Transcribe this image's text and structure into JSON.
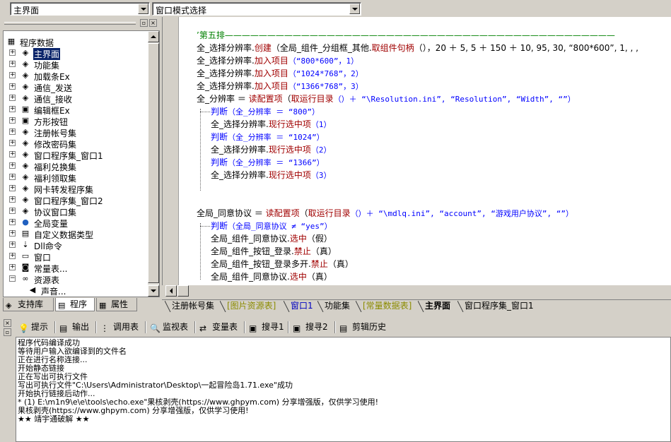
{
  "top": {
    "combo1": "主界面",
    "combo2": "窗口模式选择"
  },
  "tree": {
    "items": [
      {
        "label": "程序数据",
        "icon": "program-data-icon",
        "glyph": "▦"
      },
      {
        "label": "主界面",
        "icon": "layers-icon",
        "glyph": "◈"
      },
      {
        "label": "功能集",
        "icon": "layers-icon",
        "glyph": "◈"
      },
      {
        "label": "加载条Ex",
        "icon": "layers-icon",
        "glyph": "◈"
      },
      {
        "label": "通信_发送",
        "icon": "layers-icon",
        "glyph": "◈"
      },
      {
        "label": "通信_接收",
        "icon": "layers-icon",
        "glyph": "◈"
      },
      {
        "label": "编辑框Ex",
        "icon": "component-icon",
        "glyph": "▣"
      },
      {
        "label": "方形按钮",
        "icon": "component-icon",
        "glyph": "▣"
      },
      {
        "label": "注册帐号集",
        "icon": "layers-icon",
        "glyph": "◈"
      },
      {
        "label": "修改密码集",
        "icon": "layers-icon",
        "glyph": "◈"
      },
      {
        "label": "窗口程序集_窗口1",
        "icon": "layers-icon",
        "glyph": "◈"
      },
      {
        "label": "福利兑换集",
        "icon": "layers-icon",
        "glyph": "◈"
      },
      {
        "label": "福利领取集",
        "icon": "layers-icon",
        "glyph": "◈"
      },
      {
        "label": "网卡转发程序集",
        "icon": "layers-icon",
        "glyph": "◈"
      },
      {
        "label": "窗口程序集_窗口2",
        "icon": "layers-icon",
        "glyph": "◈"
      },
      {
        "label": "协议窗口集",
        "icon": "layers-icon",
        "glyph": "◈"
      },
      {
        "label": "全局变量",
        "icon": "globe-icon",
        "glyph": "●"
      },
      {
        "label": "自定义数据类型",
        "icon": "datatype-icon",
        "glyph": "▤"
      },
      {
        "label": "Dll命令",
        "icon": "dll-icon",
        "glyph": "⇣"
      },
      {
        "label": "窗口",
        "icon": "window-icon",
        "glyph": "▭"
      },
      {
        "label": "常量表...",
        "icon": "constant-icon",
        "glyph": "◙"
      },
      {
        "label": "资源表",
        "icon": "resource-icon",
        "glyph": "∞"
      },
      {
        "label": "声音...",
        "icon": "sound-icon",
        "glyph": "◀"
      }
    ],
    "tabs": [
      {
        "label": "支持库",
        "icon": "library-icon",
        "glyph": "◈"
      },
      {
        "label": "程序",
        "icon": "program-icon",
        "glyph": "▤"
      },
      {
        "label": "属性",
        "icon": "property-icon",
        "glyph": "▦"
      }
    ]
  },
  "code": {
    "l01": "’第五排——————————————————————————————————————————————",
    "l02a": "全_选择分辨率.",
    "l02b": "创建",
    "l02c": "（全局_组件_分组框_其他.",
    "l02d": "取组件句柄",
    "l02e": "（），20 ＋ 5, 5 ＋ 150 ＋ 10, 95, 30, “800*600”, 1, , , ",
    "l03a": "全_选择分辨率.",
    "l03b": "加入项目",
    "l03c": "（“800*600”，1）",
    "l04a": "全_选择分辨率.",
    "l04b": "加入项目",
    "l04c": "（“1024*768”，2）",
    "l05a": "全_选择分辨率.",
    "l05b": "加入项目",
    "l05c": "（“1366*768”，3）",
    "l06a": "全_分辨率 ＝ ",
    "l06b": "读配置项",
    "l06c": "（",
    "l06d": "取运行目录",
    "l06e": "（）＋ “\\Resolution.ini”, “Resolution”, “Width”, “”）",
    "l07a": "判断",
    "l07b": "（全_分辨率 ＝ “800”）",
    "l08a": "全_选择分辨率.",
    "l08b": "现行选中项",
    "l08c": "（1）",
    "l09a": "判断",
    "l09b": "（全_分辨率 ＝ “1024”）",
    "l10a": "全_选择分辨率.",
    "l10b": "现行选中项",
    "l10c": "（2）",
    "l11a": "判断",
    "l11b": "（全_分辨率 ＝ “1366”）",
    "l12a": "全_选择分辨率.",
    "l12b": "现行选中项",
    "l12c": "（3）",
    "l13a": "全局_同意协议 ＝ ",
    "l13b": "读配置项",
    "l13c": "（",
    "l13d": "取运行目录",
    "l13e": "（）＋ “\\mdlq.ini”, “account”, “游戏用户协议”, “”）",
    "l14a": "判断",
    "l14b": "（全局_同意协议 ≠ “yes”）",
    "l15a": "全局_组件_同意协议.",
    "l15b": "选中",
    "l15c": "（假）",
    "l16a": "全局_组件_按钮_登录.",
    "l16b": "禁止",
    "l16c": "（真）",
    "l17a": "全局_组件_按钮_登录多开.",
    "l17b": "禁止",
    "l17c": "（真）",
    "l18a": "全局_组件_同意协议.",
    "l18b": "选中",
    "l18c": "（真）"
  },
  "editor_tabs": [
    {
      "label": "注册帐号集",
      "style": "normal"
    },
    {
      "label": "[图片资源表]",
      "style": "orange"
    },
    {
      "label": "窗口1",
      "style": "blue"
    },
    {
      "label": "功能集",
      "style": "normal"
    },
    {
      "label": "[常量数据表]",
      "style": "orange"
    },
    {
      "label": "主界面",
      "style": "active"
    },
    {
      "label": "窗口程序集_窗口1",
      "style": "normal"
    }
  ],
  "output_tabs": [
    {
      "label": "提示",
      "icon": "hint-icon",
      "glyph": "💡"
    },
    {
      "label": "输出",
      "icon": "output-icon",
      "glyph": "▤"
    },
    {
      "label": "调用表",
      "icon": "callstack-icon",
      "glyph": "⋮"
    },
    {
      "label": "监视表",
      "icon": "watch-icon",
      "glyph": "🔍"
    },
    {
      "label": "变量表",
      "icon": "variable-icon",
      "glyph": "⇄"
    },
    {
      "label": "搜寻1",
      "icon": "search1-icon",
      "glyph": "▣"
    },
    {
      "label": "搜寻2",
      "icon": "search2-icon",
      "glyph": "▣"
    },
    {
      "label": "剪辑历史",
      "icon": "clip-history-icon",
      "glyph": "▤"
    }
  ],
  "output_lines": [
    "程序代码编译成功",
    "等待用户输入欲编译到的文件名",
    "正在进行名称连接...",
    "开始静态链接",
    "正在写出可执行文件",
    "写出可执行文件\"C:\\Users\\Administrator\\Desktop\\一起冒险岛1.71.exe\"成功",
    "开始执行链接后动作...",
    "* (1)  E:\\m1n9\\e\\e\\tools\\echo.exe\"果核剥壳(https://www.ghpym.com) 分享增强版，仅供学习使用!",
    "果核剥壳(https://www.ghpym.com) 分享增强版，仅供学习使用!",
    "★★ 靖宇通破解 ★★"
  ]
}
